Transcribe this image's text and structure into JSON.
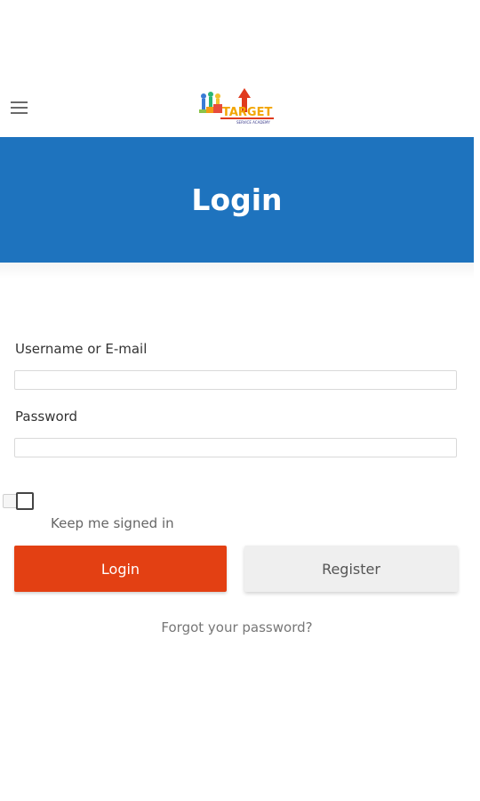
{
  "header": {
    "menu_icon": "hamburger-menu-icon",
    "logo": {
      "text": "TARGET",
      "subtext": "SERVICE ACADEMY"
    }
  },
  "banner": {
    "title": "Login",
    "color": "#1e73be"
  },
  "form": {
    "username_label": "Username or E-mail",
    "username_value": "",
    "password_label": "Password",
    "password_value": "",
    "keep_signed_in_label": "Keep me signed in",
    "keep_signed_in_checked": false
  },
  "buttons": {
    "login_label": "Login",
    "login_color": "#e34013",
    "register_label": "Register"
  },
  "links": {
    "forgot_password": "Forgot your password?"
  }
}
